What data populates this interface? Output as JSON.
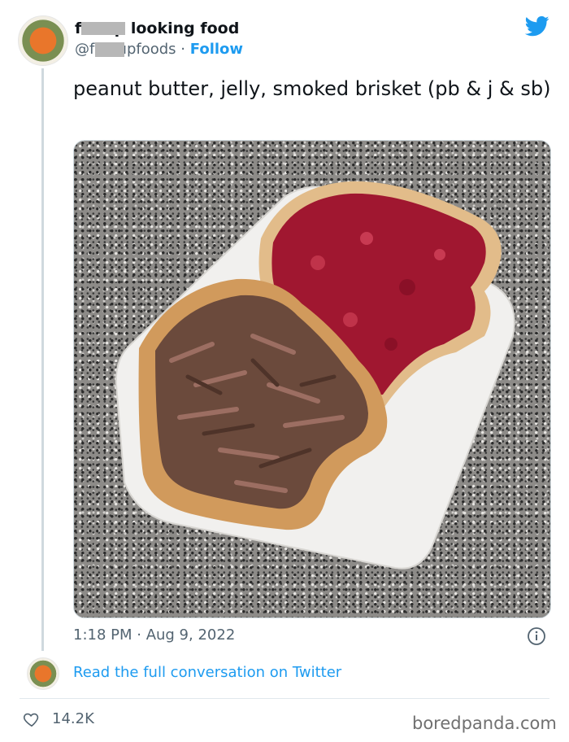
{
  "tweet": {
    "display_name": "f d up looking food",
    "handle": "@f edupfoods",
    "separator": "·",
    "follow_label": "Follow",
    "text": "peanut butter, jelly, smoked brisket (pb & j & sb)",
    "image_alt": "sandwich photo",
    "timestamp": "1:18 PM · Aug 9, 2022",
    "read_link": "Read the full conversation on Twitter",
    "likes": "14.2K"
  },
  "watermark": "boredpanda.com",
  "colors": {
    "link": "#1d9bf0",
    "muted": "#536471",
    "jelly": "#a01730",
    "bread": "#d9a66a",
    "brisket": "#6b4a3c"
  },
  "icons": [
    "twitter-bird-icon",
    "info-icon",
    "heart-icon"
  ]
}
